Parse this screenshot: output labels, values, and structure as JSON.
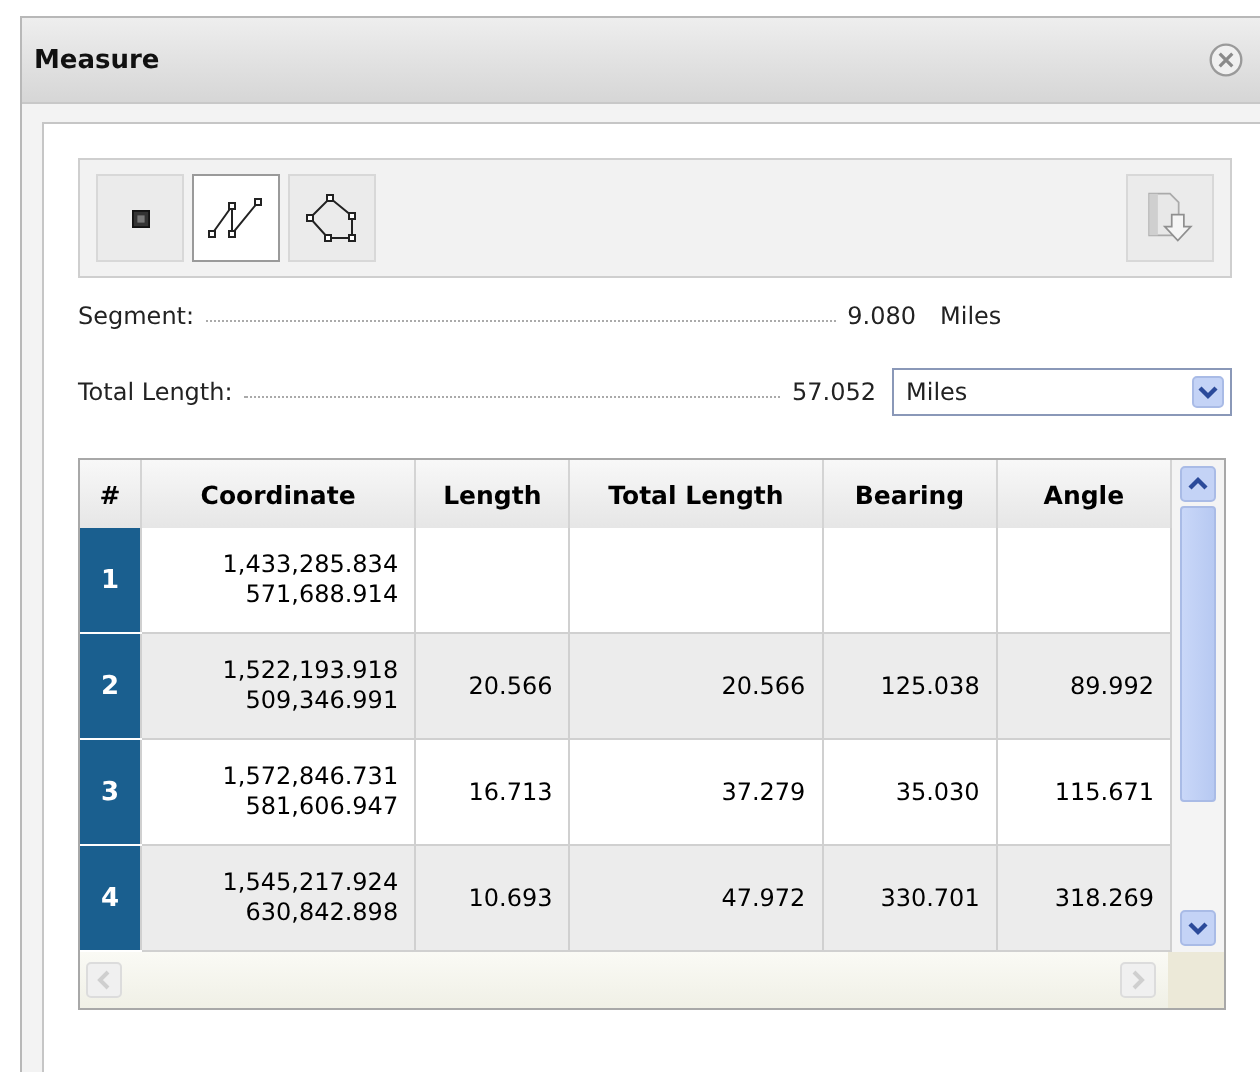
{
  "window": {
    "title": "Measure"
  },
  "tools": [
    {
      "kind": "point",
      "selected": false
    },
    {
      "kind": "line",
      "selected": true
    },
    {
      "kind": "polygon",
      "selected": false
    }
  ],
  "segment": {
    "label": "Segment:",
    "value": "9.080",
    "unit": "Miles"
  },
  "total": {
    "label": "Total Length:",
    "value": "57.052",
    "unit": "Miles"
  },
  "table": {
    "columns": [
      "#",
      "Coordinate",
      "Length",
      "Total Length",
      "Bearing",
      "Angle"
    ],
    "rows": [
      {
        "index": "1",
        "coordinate": [
          "1,433,285.834",
          "571,688.914"
        ],
        "length": "",
        "total": "",
        "bearing": "",
        "angle": ""
      },
      {
        "index": "2",
        "coordinate": [
          "1,522,193.918",
          "509,346.991"
        ],
        "length": "20.566",
        "total": "20.566",
        "bearing": "125.038",
        "angle": "89.992"
      },
      {
        "index": "3",
        "coordinate": [
          "1,572,846.731",
          "581,606.947"
        ],
        "length": "16.713",
        "total": "37.279",
        "bearing": "35.030",
        "angle": "115.671"
      },
      {
        "index": "4",
        "coordinate": [
          "1,545,217.924",
          "630,842.898"
        ],
        "length": "10.693",
        "total": "47.972",
        "bearing": "330.701",
        "angle": "318.269"
      }
    ]
  }
}
